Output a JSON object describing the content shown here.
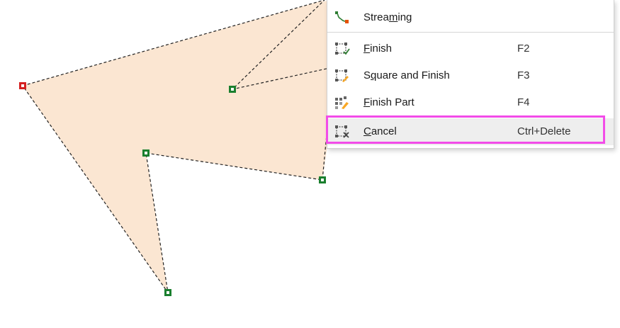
{
  "colors": {
    "polygon_fill": "#fbe6d2",
    "vertex_green": "#1a7f2e",
    "vertex_red": "#d42020",
    "highlight": "#f24ce8"
  },
  "menu": {
    "items": [
      {
        "id": "streaming",
        "label_pre": "Strea",
        "label_u": "m",
        "label_post": "ing",
        "shortcut": "",
        "icon": "streaming-icon"
      },
      {
        "id": "finish",
        "label_pre": "",
        "label_u": "F",
        "label_post": "inish",
        "shortcut": "F2",
        "icon": "finish-icon"
      },
      {
        "id": "square",
        "label_pre": "S",
        "label_u": "q",
        "label_post": "uare and Finish",
        "shortcut": "F3",
        "icon": "square-finish-icon"
      },
      {
        "id": "finish_part",
        "label_pre": "",
        "label_u": "F",
        "label_post": "inish Part",
        "shortcut": "F4",
        "icon": "finish-part-icon"
      },
      {
        "id": "cancel",
        "label_pre": "",
        "label_u": "C",
        "label_post": "ancel",
        "shortcut": "Ctrl+Delete",
        "icon": "cancel-icon"
      }
    ]
  }
}
